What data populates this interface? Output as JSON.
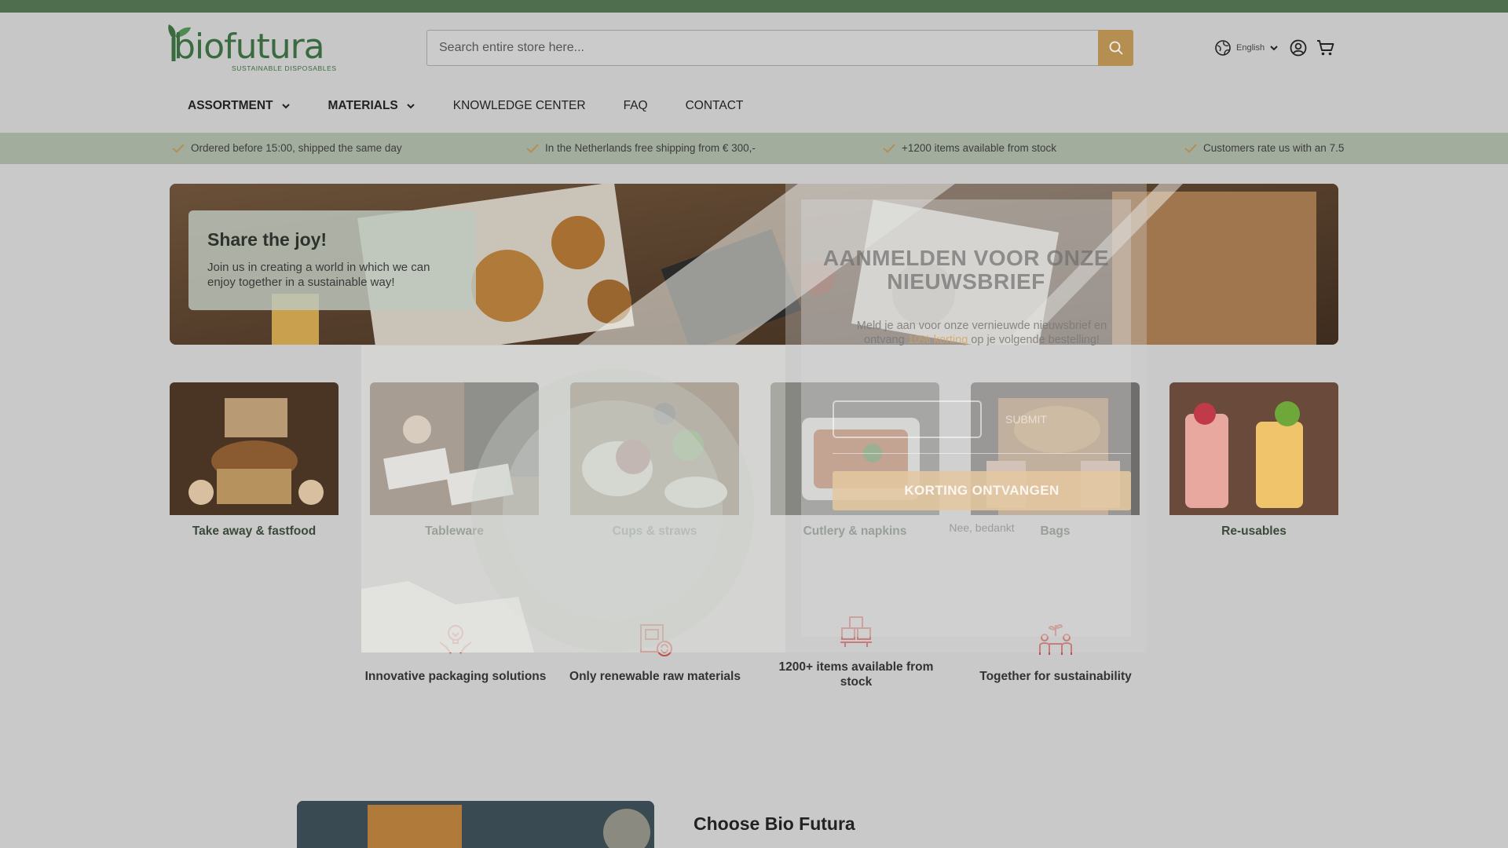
{
  "brand": {
    "logo_text": "biofutura",
    "logo_tagline": "SUSTAINABLE DISPOSABLES",
    "primary_color": "#4f6e4e",
    "accent_color": "#b58f52"
  },
  "search": {
    "placeholder": "Search entire store here..."
  },
  "header": {
    "language": "English"
  },
  "nav": {
    "assortment": "ASSORTMENT",
    "materials": "MATERIALS",
    "knowledge": "KNOWLEDGE CENTER",
    "faq": "FAQ",
    "contact": "CONTACT"
  },
  "usps": [
    "Ordered before 15:00, shipped the same day",
    "In the Netherlands free shipping from € 300,-",
    "+1200 items available from stock",
    "Customers rate us with an 7.5"
  ],
  "hero": {
    "title": "Share the joy!",
    "text": "Join us in creating a world in which we can enjoy together in a sustainable way!"
  },
  "categories": [
    "Take away & fastfood",
    "Tableware",
    "Cups & straws",
    "Cutlery & napkins",
    "Bags",
    "Re-usables"
  ],
  "features": [
    "Innovative packaging solutions",
    "Only renewable raw materials",
    "1200+ items available from stock",
    "Together for sustainability"
  ],
  "section": {
    "choose_title": "Choose Bio Futura"
  },
  "newsletter_modal": {
    "title": "AANMELDEN VOOR ONZE NIEUWSBRIEF",
    "text_before": "Meld je aan voor onze vernieuwde nieuwsbrief en ontvang ",
    "text_highlight": "10% korting",
    "text_after": " op je volgende bestelling!",
    "field_label": "SUBMIT",
    "cta": "KORTING ONTVANGEN",
    "decline": "Nee, bedankt"
  }
}
